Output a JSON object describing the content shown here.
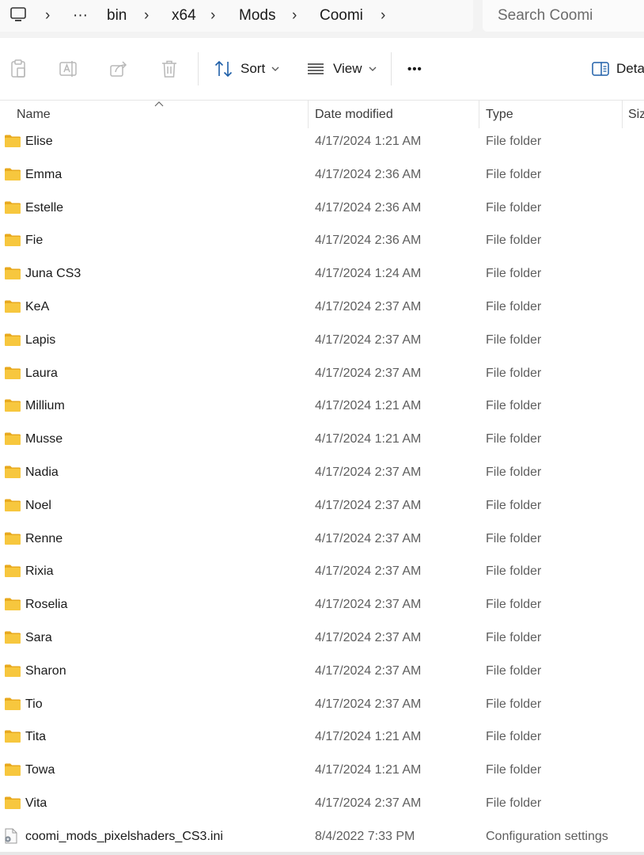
{
  "breadcrumb": {
    "more": "···",
    "items": [
      "bin",
      "x64",
      "Mods",
      "Coomi"
    ],
    "separator": "›"
  },
  "search": {
    "placeholder": "Search Coomi"
  },
  "toolbar": {
    "sort_label": "Sort",
    "view_label": "View",
    "more_label": "•••",
    "details_label": "Deta"
  },
  "columns": {
    "name": "Name",
    "date": "Date modified",
    "type": "Type",
    "size": "Siz"
  },
  "colors": {
    "folder": "#f7c73e",
    "folder_tab": "#e8a91e",
    "accent": "#0a64c8"
  },
  "files": [
    {
      "name": "Elise",
      "date": "4/17/2024 1:21 AM",
      "type": "File folder",
      "kind": "folder"
    },
    {
      "name": "Emma",
      "date": "4/17/2024 2:36 AM",
      "type": "File folder",
      "kind": "folder"
    },
    {
      "name": "Estelle",
      "date": "4/17/2024 2:36 AM",
      "type": "File folder",
      "kind": "folder"
    },
    {
      "name": "Fie",
      "date": "4/17/2024 2:36 AM",
      "type": "File folder",
      "kind": "folder"
    },
    {
      "name": "Juna CS3",
      "date": "4/17/2024 1:24 AM",
      "type": "File folder",
      "kind": "folder"
    },
    {
      "name": "KeA",
      "date": "4/17/2024 2:37 AM",
      "type": "File folder",
      "kind": "folder"
    },
    {
      "name": "Lapis",
      "date": "4/17/2024 2:37 AM",
      "type": "File folder",
      "kind": "folder"
    },
    {
      "name": "Laura",
      "date": "4/17/2024 2:37 AM",
      "type": "File folder",
      "kind": "folder"
    },
    {
      "name": "Millium",
      "date": "4/17/2024 1:21 AM",
      "type": "File folder",
      "kind": "folder"
    },
    {
      "name": "Musse",
      "date": "4/17/2024 1:21 AM",
      "type": "File folder",
      "kind": "folder"
    },
    {
      "name": "Nadia",
      "date": "4/17/2024 2:37 AM",
      "type": "File folder",
      "kind": "folder"
    },
    {
      "name": "Noel",
      "date": "4/17/2024 2:37 AM",
      "type": "File folder",
      "kind": "folder"
    },
    {
      "name": "Renne",
      "date": "4/17/2024 2:37 AM",
      "type": "File folder",
      "kind": "folder"
    },
    {
      "name": "Rixia",
      "date": "4/17/2024 2:37 AM",
      "type": "File folder",
      "kind": "folder"
    },
    {
      "name": "Roselia",
      "date": "4/17/2024 2:37 AM",
      "type": "File folder",
      "kind": "folder"
    },
    {
      "name": "Sara",
      "date": "4/17/2024 2:37 AM",
      "type": "File folder",
      "kind": "folder"
    },
    {
      "name": "Sharon",
      "date": "4/17/2024 2:37 AM",
      "type": "File folder",
      "kind": "folder"
    },
    {
      "name": "Tio",
      "date": "4/17/2024 2:37 AM",
      "type": "File folder",
      "kind": "folder"
    },
    {
      "name": "Tita",
      "date": "4/17/2024 1:21 AM",
      "type": "File folder",
      "kind": "folder"
    },
    {
      "name": "Towa",
      "date": "4/17/2024 1:21 AM",
      "type": "File folder",
      "kind": "folder"
    },
    {
      "name": "Vita",
      "date": "4/17/2024 2:37 AM",
      "type": "File folder",
      "kind": "folder"
    },
    {
      "name": "coomi_mods_pixelshaders_CS3.ini",
      "date": "8/4/2022 7:33 PM",
      "type": "Configuration settings",
      "kind": "ini"
    }
  ]
}
